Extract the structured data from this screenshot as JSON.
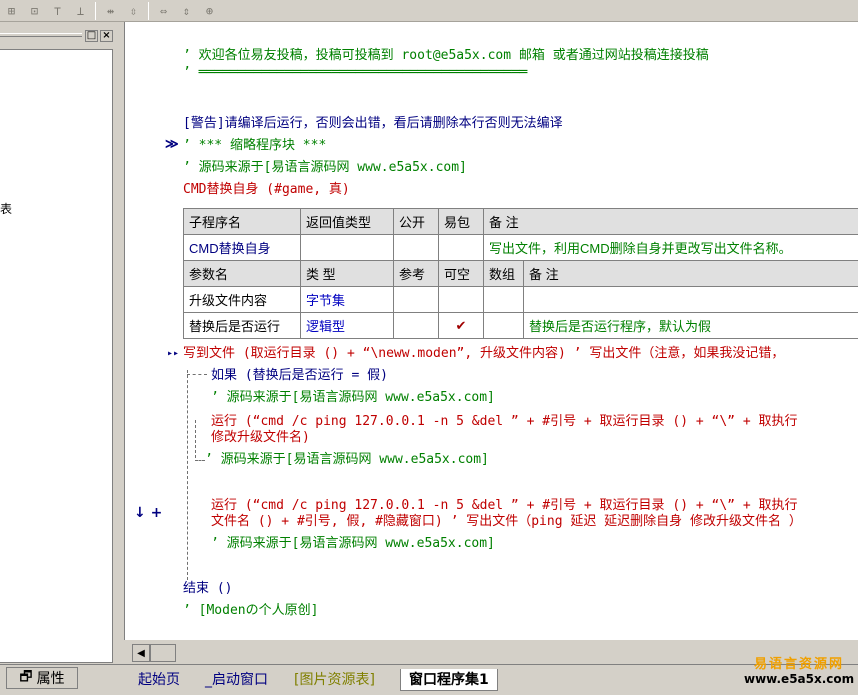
{
  "toolbar": {
    "icons": [
      "align-left-icon",
      "align-center-icon",
      "align-top-icon",
      "align-middle-icon",
      "h-spacing-icon",
      "v-spacing-icon",
      "same-width-icon",
      "same-height-icon",
      "same-size-icon"
    ]
  },
  "left_panel": {
    "title_buttons": [
      "□",
      "×"
    ],
    "fragment_text": "表"
  },
  "code": {
    "header_comment": "’ 欢迎各位易友投稿，投稿可投稿到   root@e5a5x.com  邮箱 或者通过网站投稿连接投稿",
    "header_rule": "’ ══════════════════════════════════════════",
    "warning": "[警告]请编译后运行，否则会出错，看后请删除本行否则无法编译",
    "collapse_marker": "≫",
    "folded_block": "’ *** 缩略程序块 ***",
    "source_comment": "’ 源码来源于[易语言源码网 www.e5a5x.com]",
    "set_call": "CMD替换自身 (#game, 真)",
    "table": {
      "header": [
        "子程序名",
        "返回值类型",
        "公开",
        "易包",
        "备 注"
      ],
      "sub_row": [
        "CMD替换自身",
        "",
        "",
        "",
        "写出文件，利用CMD删除自身并更改写出文件名称。"
      ],
      "param_header": [
        "参数名",
        "类 型",
        "参考",
        "可空",
        "数组",
        "备 注"
      ],
      "params": [
        [
          "升级文件内容",
          "字节集",
          "",
          "",
          "",
          ""
        ],
        [
          "替换后是否运行",
          "逻辑型",
          "",
          "✔",
          "",
          "替换后是否运行程序，默认为假"
        ]
      ]
    },
    "write_file_marker": "▸▸",
    "write_file": "写到文件 (取运行目录 () + “\\neww.moden”, 升级文件内容)  ’ 写出文件（注意，如果我没记错，",
    "if_line": "如果 (替换后是否运行 = 假)",
    "if_comment": "’ 源码来源于[易语言源码网 www.e5a5x.com]",
    "run1_a": "运行 (“cmd /c ping 127.0.0.1 -n 5 &del ” + #引号 + 取运行目录 () + “\\” + 取执行",
    "run1_b": "修改升级文件名)",
    "else_comment": "’ 源码来源于[易语言源码网 www.e5a5x.com]",
    "row_markers": "↓ +",
    "run2_a": "运行 (“cmd /c ping 127.0.0.1 -n 5 &del ” + #引号 + 取运行目录 () + “\\” + 取执行",
    "run2_b": "文件名 () + #引号, 假, #隐藏窗口)  ’ 写出文件（ping 延迟 延迟删除自身 修改升级文件名 ）",
    "run2_comment": "’ 源码来源于[易语言源码网 www.e5a5x.com]",
    "end_line": "结束 ()",
    "footer_comment": "’ [Modenの个人原创]"
  },
  "scrollbar": {
    "left_arrow": "◀"
  },
  "tabs": {
    "properties_label": "属性",
    "items": [
      "起始页",
      "_启动窗口",
      "[图片资源表]",
      "窗口程序集1"
    ]
  },
  "watermark": {
    "line1": "易语言资源网",
    "line2": "www.e5a5x.com"
  },
  "colors": {
    "comment": "#008000",
    "keyword": "#000080",
    "call": "#c00000",
    "type": "#0000c0"
  }
}
